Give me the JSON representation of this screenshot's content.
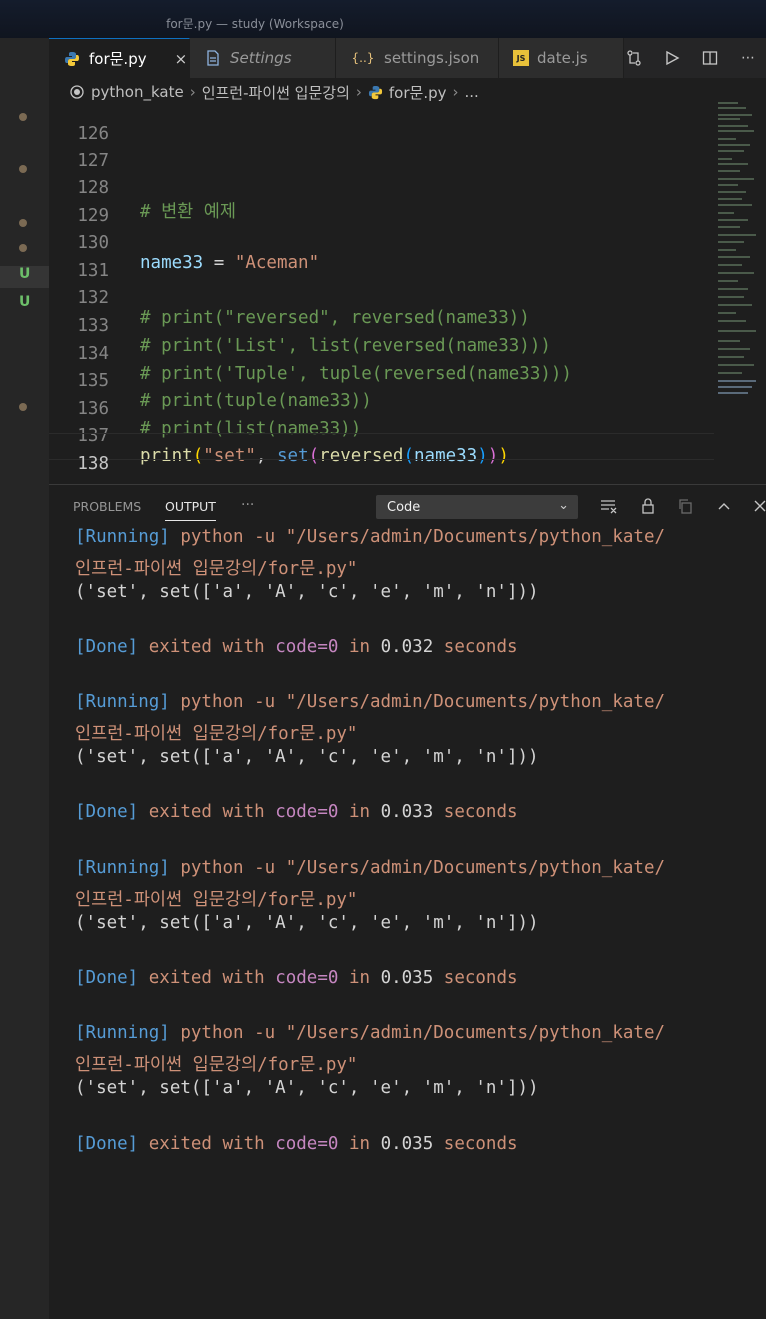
{
  "window": {
    "title": "for문.py — study (Workspace)"
  },
  "tabs": [
    {
      "label": "for문.py",
      "icon": "python-icon",
      "active": true,
      "close": "×"
    },
    {
      "label": "Settings",
      "icon": "settings-file-icon",
      "italic": true
    },
    {
      "label": "settings.json",
      "icon": "json-braces-icon",
      "icon_text": "{..}"
    },
    {
      "label": "date.js",
      "icon": "js-icon",
      "icon_text": "JS"
    }
  ],
  "breadcrumb": {
    "folder": "python_kate",
    "subfolder": "인프런-파이썬 입문강의",
    "file": "for문.py",
    "more": "..."
  },
  "editor": {
    "gutter_marks": [
      "U",
      "U"
    ],
    "lines": [
      {
        "num": "126",
        "text": ""
      },
      {
        "num": "127",
        "text": ""
      },
      {
        "num": "128",
        "comment": "# 변환 예제"
      },
      {
        "num": "129",
        "text": ""
      },
      {
        "num": "130",
        "var": "name33",
        "op": " = ",
        "str": "\"Aceman\""
      },
      {
        "num": "131",
        "text": ""
      },
      {
        "num": "132",
        "comment": "# print(\"reversed\", reversed(name33))"
      },
      {
        "num": "133",
        "comment": "# print('List', list(reversed(name33)))"
      },
      {
        "num": "134",
        "comment": "# print('Tuple', tuple(reversed(name33)))"
      },
      {
        "num": "135",
        "comment": "# print(tuple(name33))"
      },
      {
        "num": "136",
        "comment": "# print(list(name33))"
      },
      {
        "num": "137",
        "fn": "print",
        "str": "\"set\"",
        "comma": ", ",
        "set": "set",
        "rev": "reversed",
        "var": "name33"
      },
      {
        "num": "138",
        "text": ""
      }
    ]
  },
  "panel": {
    "tabs": [
      "PROBLEMS",
      "OUTPUT"
    ],
    "active_tab": "OUTPUT",
    "more": "···",
    "dropdown_value": "Code",
    "runs": [
      {
        "running_tag": "[Running]",
        "command": " python -u \"/Users/admin/Documents/python_kate/",
        "command_cont": "인프런-파이썬 입문강의/for문.py\"",
        "result": "('set', set(['a', 'A', 'c', 'e', 'm', 'n']))",
        "done_tag": "[Done]",
        "exited": " exited with ",
        "code": "code=0",
        "in": " in ",
        "time": "0.032",
        "seconds": " seconds"
      },
      {
        "running_tag": "[Running]",
        "command": " python -u \"/Users/admin/Documents/python_kate/",
        "command_cont": "인프런-파이썬 입문강의/for문.py\"",
        "result": "('set', set(['a', 'A', 'c', 'e', 'm', 'n']))",
        "done_tag": "[Done]",
        "exited": " exited with ",
        "code": "code=0",
        "in": " in ",
        "time": "0.033",
        "seconds": " seconds"
      },
      {
        "running_tag": "[Running]",
        "command": " python -u \"/Users/admin/Documents/python_kate/",
        "command_cont": "인프런-파이썬 입문강의/for문.py\"",
        "result": "('set', set(['a', 'A', 'c', 'e', 'm', 'n']))",
        "done_tag": "[Done]",
        "exited": " exited with ",
        "code": "code=0",
        "in": " in ",
        "time": "0.035",
        "seconds": " seconds"
      },
      {
        "running_tag": "[Running]",
        "command": " python -u \"/Users/admin/Documents/python_kate/",
        "command_cont": "인프런-파이썬 입문강의/for문.py\"",
        "result": "('set', set(['a', 'A', 'c', 'e', 'm', 'n']))",
        "done_tag": "[Done]",
        "exited": " exited with ",
        "code": "code=0",
        "in": " in ",
        "time": "0.035",
        "seconds": " seconds"
      }
    ]
  }
}
